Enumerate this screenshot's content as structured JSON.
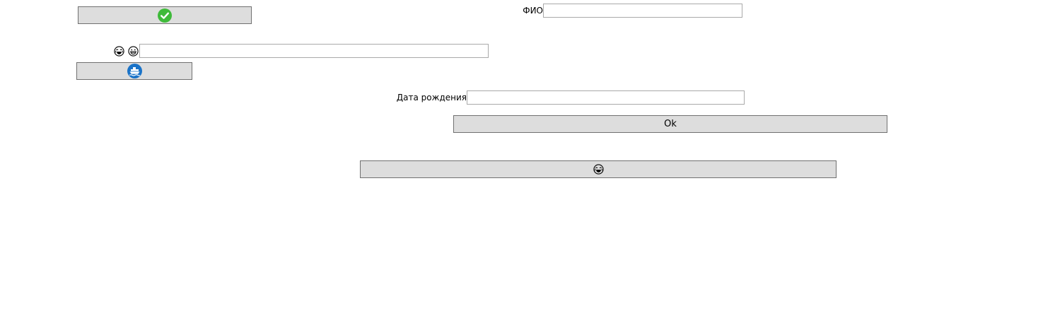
{
  "form": {
    "fio_label": "ФИО",
    "fio_value": "",
    "birthdate_label": "Дата рождения",
    "birthdate_value": "",
    "ok_label": "Ok",
    "emoji_field_value": ""
  },
  "icons": {
    "confirm": "check-circle-icon",
    "ship": "ship-icon",
    "emoji_1": "laughing-face-icon",
    "emoji_2": "grinning-face-icon",
    "emoji_button": "laughing-face-icon"
  },
  "colors": {
    "button_bg": "#dddddd",
    "button_border": "#707070",
    "field_border": "#a9a9a9",
    "check_green": "#3fba3a",
    "ship_blue": "#1a73c8"
  }
}
